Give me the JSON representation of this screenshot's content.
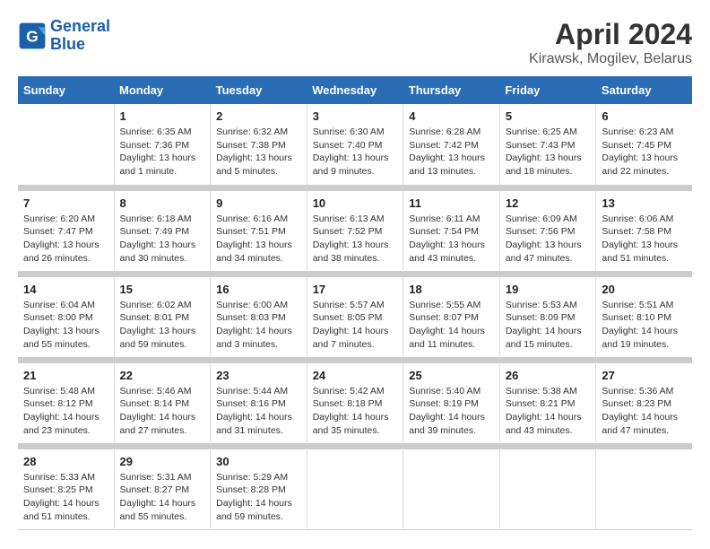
{
  "logo": {
    "text_general": "General",
    "text_blue": "Blue"
  },
  "title": "April 2024",
  "subtitle": "Kirawsk, Mogilev, Belarus",
  "columns": [
    "Sunday",
    "Monday",
    "Tuesday",
    "Wednesday",
    "Thursday",
    "Friday",
    "Saturday"
  ],
  "weeks": [
    {
      "days": [
        {
          "num": "",
          "info": ""
        },
        {
          "num": "1",
          "info": "Sunrise: 6:35 AM\nSunset: 7:36 PM\nDaylight: 13 hours\nand 1 minute."
        },
        {
          "num": "2",
          "info": "Sunrise: 6:32 AM\nSunset: 7:38 PM\nDaylight: 13 hours\nand 5 minutes."
        },
        {
          "num": "3",
          "info": "Sunrise: 6:30 AM\nSunset: 7:40 PM\nDaylight: 13 hours\nand 9 minutes."
        },
        {
          "num": "4",
          "info": "Sunrise: 6:28 AM\nSunset: 7:42 PM\nDaylight: 13 hours\nand 13 minutes."
        },
        {
          "num": "5",
          "info": "Sunrise: 6:25 AM\nSunset: 7:43 PM\nDaylight: 13 hours\nand 18 minutes."
        },
        {
          "num": "6",
          "info": "Sunrise: 6:23 AM\nSunset: 7:45 PM\nDaylight: 13 hours\nand 22 minutes."
        }
      ]
    },
    {
      "days": [
        {
          "num": "7",
          "info": "Sunrise: 6:20 AM\nSunset: 7:47 PM\nDaylight: 13 hours\nand 26 minutes."
        },
        {
          "num": "8",
          "info": "Sunrise: 6:18 AM\nSunset: 7:49 PM\nDaylight: 13 hours\nand 30 minutes."
        },
        {
          "num": "9",
          "info": "Sunrise: 6:16 AM\nSunset: 7:51 PM\nDaylight: 13 hours\nand 34 minutes."
        },
        {
          "num": "10",
          "info": "Sunrise: 6:13 AM\nSunset: 7:52 PM\nDaylight: 13 hours\nand 38 minutes."
        },
        {
          "num": "11",
          "info": "Sunrise: 6:11 AM\nSunset: 7:54 PM\nDaylight: 13 hours\nand 43 minutes."
        },
        {
          "num": "12",
          "info": "Sunrise: 6:09 AM\nSunset: 7:56 PM\nDaylight: 13 hours\nand 47 minutes."
        },
        {
          "num": "13",
          "info": "Sunrise: 6:06 AM\nSunset: 7:58 PM\nDaylight: 13 hours\nand 51 minutes."
        }
      ]
    },
    {
      "days": [
        {
          "num": "14",
          "info": "Sunrise: 6:04 AM\nSunset: 8:00 PM\nDaylight: 13 hours\nand 55 minutes."
        },
        {
          "num": "15",
          "info": "Sunrise: 6:02 AM\nSunset: 8:01 PM\nDaylight: 13 hours\nand 59 minutes."
        },
        {
          "num": "16",
          "info": "Sunrise: 6:00 AM\nSunset: 8:03 PM\nDaylight: 14 hours\nand 3 minutes."
        },
        {
          "num": "17",
          "info": "Sunrise: 5:57 AM\nSunset: 8:05 PM\nDaylight: 14 hours\nand 7 minutes."
        },
        {
          "num": "18",
          "info": "Sunrise: 5:55 AM\nSunset: 8:07 PM\nDaylight: 14 hours\nand 11 minutes."
        },
        {
          "num": "19",
          "info": "Sunrise: 5:53 AM\nSunset: 8:09 PM\nDaylight: 14 hours\nand 15 minutes."
        },
        {
          "num": "20",
          "info": "Sunrise: 5:51 AM\nSunset: 8:10 PM\nDaylight: 14 hours\nand 19 minutes."
        }
      ]
    },
    {
      "days": [
        {
          "num": "21",
          "info": "Sunrise: 5:48 AM\nSunset: 8:12 PM\nDaylight: 14 hours\nand 23 minutes."
        },
        {
          "num": "22",
          "info": "Sunrise: 5:46 AM\nSunset: 8:14 PM\nDaylight: 14 hours\nand 27 minutes."
        },
        {
          "num": "23",
          "info": "Sunrise: 5:44 AM\nSunset: 8:16 PM\nDaylight: 14 hours\nand 31 minutes."
        },
        {
          "num": "24",
          "info": "Sunrise: 5:42 AM\nSunset: 8:18 PM\nDaylight: 14 hours\nand 35 minutes."
        },
        {
          "num": "25",
          "info": "Sunrise: 5:40 AM\nSunset: 8:19 PM\nDaylight: 14 hours\nand 39 minutes."
        },
        {
          "num": "26",
          "info": "Sunrise: 5:38 AM\nSunset: 8:21 PM\nDaylight: 14 hours\nand 43 minutes."
        },
        {
          "num": "27",
          "info": "Sunrise: 5:36 AM\nSunset: 8:23 PM\nDaylight: 14 hours\nand 47 minutes."
        }
      ]
    },
    {
      "days": [
        {
          "num": "28",
          "info": "Sunrise: 5:33 AM\nSunset: 8:25 PM\nDaylight: 14 hours\nand 51 minutes."
        },
        {
          "num": "29",
          "info": "Sunrise: 5:31 AM\nSunset: 8:27 PM\nDaylight: 14 hours\nand 55 minutes."
        },
        {
          "num": "30",
          "info": "Sunrise: 5:29 AM\nSunset: 8:28 PM\nDaylight: 14 hours\nand 59 minutes."
        },
        {
          "num": "",
          "info": ""
        },
        {
          "num": "",
          "info": ""
        },
        {
          "num": "",
          "info": ""
        },
        {
          "num": "",
          "info": ""
        }
      ]
    }
  ]
}
